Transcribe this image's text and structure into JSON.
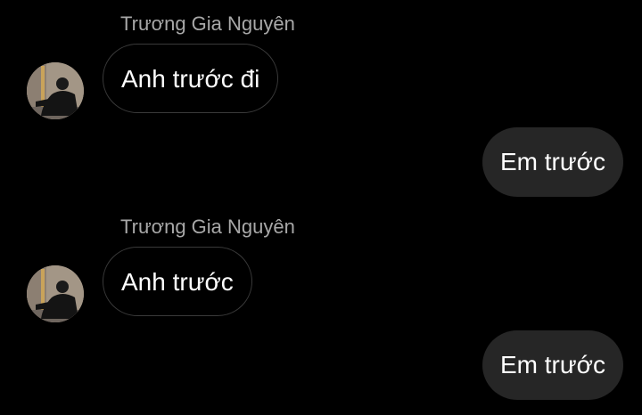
{
  "colors": {
    "background": "#000000",
    "sender_name": "#a8a8a8",
    "incoming_border": "#3a3a3a",
    "outgoing_bubble": "#262626",
    "text": "#ffffff"
  },
  "messages": [
    {
      "direction": "incoming",
      "sender": "Trương Gia Nguyên",
      "avatar_icon": "person-photo-icon",
      "text": "Anh trước đi"
    },
    {
      "direction": "outgoing",
      "text": "Em trước"
    },
    {
      "direction": "incoming",
      "sender": "Trương Gia Nguyên",
      "avatar_icon": "person-photo-icon",
      "text": "Anh trước"
    },
    {
      "direction": "outgoing",
      "text": "Em trước"
    }
  ]
}
